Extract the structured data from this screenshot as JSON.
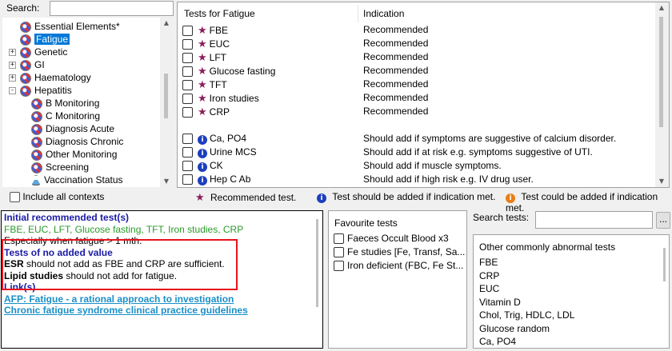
{
  "search": {
    "label": "Search:",
    "value": ""
  },
  "tree": [
    {
      "label": "Essential Elements*",
      "icon": "dna-icon",
      "expander": "",
      "indent": 0
    },
    {
      "label": "Fatigue",
      "icon": "dna-icon",
      "expander": "",
      "indent": 0,
      "selected": true
    },
    {
      "label": "Genetic",
      "icon": "dna-icon",
      "expander": "+",
      "indent": 0
    },
    {
      "label": "GI",
      "icon": "dna-icon",
      "expander": "+",
      "indent": 0
    },
    {
      "label": "Haematology",
      "icon": "dna-icon",
      "expander": "+",
      "indent": 0
    },
    {
      "label": "Hepatitis",
      "icon": "dna-icon",
      "expander": "-",
      "indent": 0
    },
    {
      "label": "B Monitoring",
      "icon": "dna-icon",
      "expander": "",
      "indent": 1
    },
    {
      "label": "C Monitoring",
      "icon": "dna-icon",
      "expander": "",
      "indent": 1
    },
    {
      "label": "Diagnosis Acute",
      "icon": "dna-icon",
      "expander": "",
      "indent": 1
    },
    {
      "label": "Diagnosis Chronic",
      "icon": "dna-icon",
      "expander": "",
      "indent": 1
    },
    {
      "label": "Other Monitoring",
      "icon": "dna-icon",
      "expander": "",
      "indent": 1
    },
    {
      "label": "Screening",
      "icon": "dna-icon",
      "expander": "",
      "indent": 1
    },
    {
      "label": "Vaccination Status",
      "icon": "flask-icon",
      "expander": "",
      "indent": 1
    }
  ],
  "tests_header": {
    "col1": "Tests for  Fatigue",
    "col2": "Indication"
  },
  "tests": [
    {
      "name": "FBE",
      "kind": "star",
      "indication": "Recommended"
    },
    {
      "name": "EUC",
      "kind": "star",
      "indication": "Recommended"
    },
    {
      "name": "LFT",
      "kind": "star",
      "indication": "Recommended"
    },
    {
      "name": "Glucose fasting",
      "kind": "star",
      "indication": "Recommended"
    },
    {
      "name": "TFT",
      "kind": "star",
      "indication": "Recommended"
    },
    {
      "name": "Iron studies",
      "kind": "star",
      "indication": "Recommended"
    },
    {
      "name": "CRP",
      "kind": "star",
      "indication": "Recommended"
    },
    {
      "name": "Ca, PO4",
      "kind": "info",
      "indication": "Should add if symptoms are suggestive of calcium disorder."
    },
    {
      "name": "Urine MCS",
      "kind": "info",
      "indication": "Should add if at risk e.g. symptoms suggestive of UTI."
    },
    {
      "name": "CK",
      "kind": "info",
      "indication": "Should add if muscle symptoms."
    },
    {
      "name": "Hep C Ab",
      "kind": "info",
      "indication": "Should add if high risk e.g. IV drug user."
    }
  ],
  "include_all_contexts": "Include all contexts",
  "legend": {
    "recommended": "Recommended test.",
    "should": "Test should be added if indication met.",
    "could": "Test could be added if indication met."
  },
  "info_panel": {
    "initial_heading": "Initial recommended test(s)",
    "initial_tests": "FBE, EUC, LFT, Glucose fasting, TFT, Iron studies, CRP",
    "especially": "Especially when fatigue > 1 mth.",
    "no_value_heading": "Tests of no added value",
    "esr_bold": "ESR",
    "esr_text": " should not add as FBE and CRP are sufficient.",
    "lipid_bold": "Lipid studies",
    "lipid_text": " should not add for fatigue.",
    "links_heading": "Link(s)",
    "link1": "AFP: Fatigue - a rational approach to investigation",
    "link2": "Chronic fatigue syndrome clinical practice guidelines"
  },
  "favourites": {
    "title": "Favourite tests",
    "items": [
      "Faeces Occult Blood x3",
      "Fe studies [Fe, Transf, Sa...",
      "Iron deficient (FBC, Fe St..."
    ]
  },
  "search_tests": {
    "label": "Search tests:",
    "value": "",
    "button": "..."
  },
  "other_tests": {
    "title": "Other commonly abnormal tests",
    "items": [
      "FBE",
      "CRP",
      "EUC",
      "Vitamin D",
      "Chol, Trig, HDLC, LDL",
      "Glucose random",
      "Ca, PO4"
    ]
  },
  "colors": {
    "accent": "#0078d7",
    "star": "#8b1e5c",
    "info": "#1d3fbf",
    "could": "#e87e15",
    "highlight": "#e8141c"
  }
}
